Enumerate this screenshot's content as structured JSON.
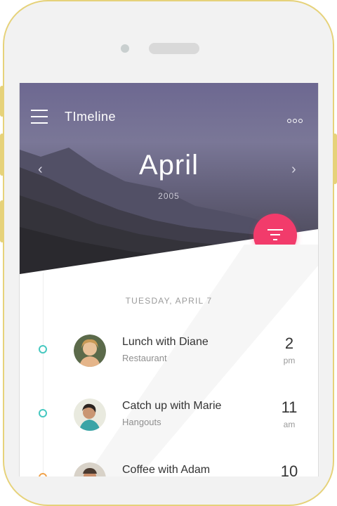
{
  "app": {
    "title": "TImeline"
  },
  "header": {
    "month": "April",
    "year": "2005",
    "prev_icon": "chevron-left-icon",
    "next_icon": "chevron-right-icon",
    "menu_icon": "hamburger-menu-icon",
    "more_icon": "more-dots-icon"
  },
  "fab": {
    "icon": "filter-icon",
    "color": "#f23b6b"
  },
  "timeline": {
    "date_label": "TUESDAY, APRIL 7",
    "events": [
      {
        "title": "Lunch with Diane",
        "subtitle": "Restaurant",
        "time": "2",
        "unit": "pm",
        "dot_color": "#46c8c0"
      },
      {
        "title": "Catch up with Marie",
        "subtitle": "Hangouts",
        "time": "11",
        "unit": "am",
        "dot_color": "#46c8c0"
      },
      {
        "title": "Coffee with Adam",
        "subtitle": "",
        "time": "10",
        "unit": "",
        "dot_color": "#f0a24a"
      }
    ]
  },
  "colors": {
    "accent": "#f23b6b",
    "timeline_dot": "#46c8c0",
    "phone_frame": "#e6d27a"
  }
}
